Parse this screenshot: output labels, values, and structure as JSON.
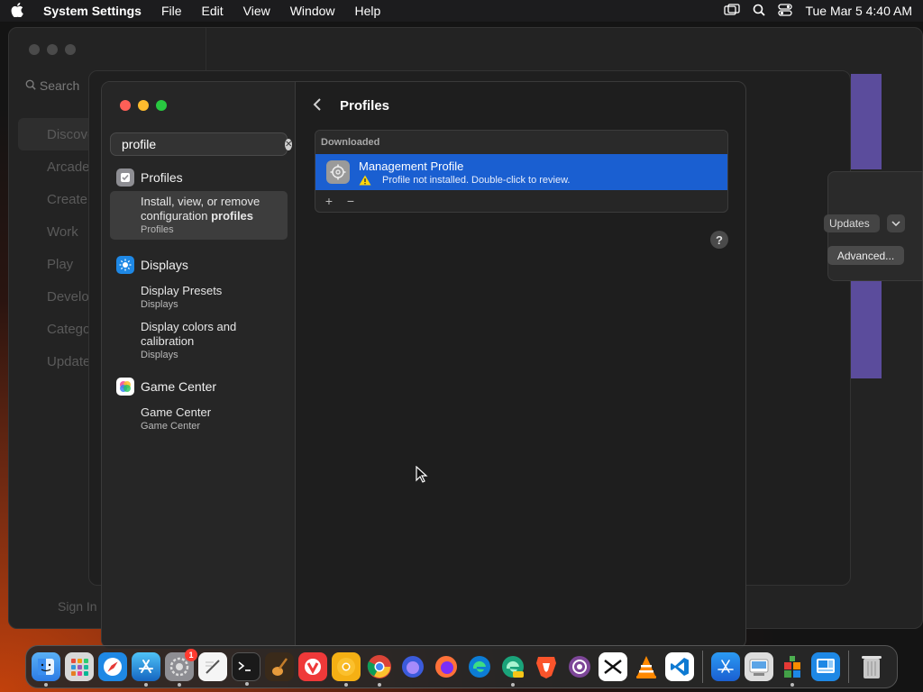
{
  "menubar": {
    "app_name": "System Settings",
    "menus": [
      "File",
      "Edit",
      "View",
      "Window",
      "Help"
    ],
    "datetime": "Tue Mar 5  4:40 AM"
  },
  "background_app": {
    "search_placeholder": "Search",
    "nav": [
      "Discover",
      "Arcade",
      "Create",
      "Work",
      "Play",
      "Develop",
      "Categories",
      "Updates"
    ],
    "sign_in": "Sign In",
    "updates_button": "Updates",
    "advanced_button": "Advanced..."
  },
  "sidebar": {
    "search_value": "profile",
    "groups": [
      {
        "label": "Profiles",
        "icon": "profiles-icon",
        "results": [
          {
            "title_prefix": "Install, view, or remove configuration ",
            "title_bold": "profiles",
            "subtitle": "Profiles",
            "selected": true
          }
        ]
      },
      {
        "label": "Displays",
        "icon": "displays-icon",
        "results": [
          {
            "title": "Display Presets",
            "subtitle": "Displays"
          },
          {
            "title": "Display colors and calibration",
            "subtitle": "Displays"
          }
        ]
      },
      {
        "label": "Game Center",
        "icon": "game-center-icon",
        "results": [
          {
            "title": "Game Center",
            "subtitle": "Game Center"
          }
        ]
      }
    ]
  },
  "content": {
    "title": "Profiles",
    "section_header": "Downloaded",
    "profile": {
      "name": "Management Profile",
      "status": "Profile not installed. Double-click to review."
    },
    "add_label": "+",
    "remove_label": "−",
    "help_label": "?"
  },
  "dock": {
    "apps": [
      "Finder",
      "Launchpad",
      "Safari",
      "App Store",
      "System Settings",
      "TextEdit",
      "Terminal",
      "GarageBand",
      "Vivaldi",
      "Chromium",
      "Chrome",
      "Firefox Developer",
      "Firefox",
      "Edge",
      "Edge Canary",
      "Brave",
      "Tor",
      "CapCut",
      "VLC",
      "VS Code",
      "Xcode Simulator",
      "Preview",
      "Unknown",
      "Unknown",
      "Trash"
    ],
    "settings_badge": "1"
  },
  "colors": {
    "accent": "#1a5fd1",
    "window_bg": "#1e1e1e",
    "sidebar_bg": "#262626"
  }
}
